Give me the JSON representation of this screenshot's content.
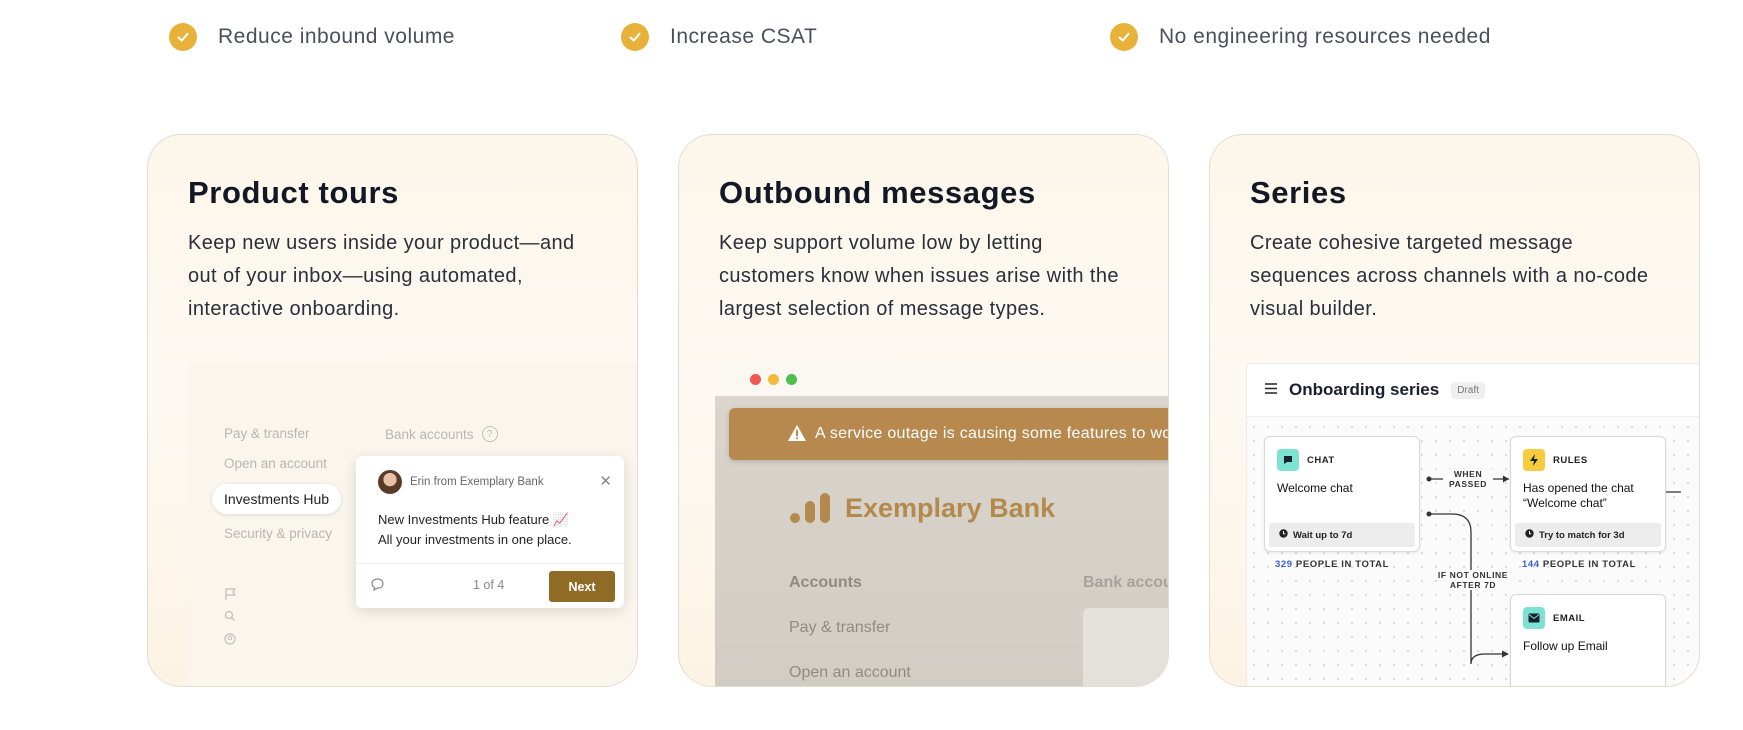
{
  "benefits": [
    {
      "label": "Reduce inbound volume"
    },
    {
      "label": "Increase CSAT"
    },
    {
      "label": "No engineering resources needed"
    }
  ],
  "colors": {
    "accent": "#e8b23a",
    "button_brown": "#8f6b26",
    "banner": "#b8894e",
    "stat_blue": "#3d5bd6"
  },
  "cards": [
    {
      "title": "Product tours",
      "description": "Keep new users inside your product—and out of your inbox—using automated, interactive onboarding.",
      "mockup": {
        "nav": [
          "Pay & transfer",
          "Open an account",
          "Investments Hub",
          "Security & privacy"
        ],
        "bank_accounts": "Bank accounts",
        "help_icon": "?",
        "tour": {
          "sender": "Erin from Exemplary Bank",
          "line1": "New Investments Hub feature 📈",
          "line2": "All your investments in one place.",
          "counter": "1 of 4",
          "next_label": "Next"
        }
      }
    },
    {
      "title": "Outbound messages",
      "description": "Keep support volume low by letting customers know when issues arise with the largest selection of message types.",
      "mockup": {
        "banner": "A service outage is causing some features to wor",
        "brand": "Exemplary Bank",
        "accounts": "Accounts",
        "bank_accounts": "Bank accou",
        "links": [
          "Pay & transfer",
          "Open an account"
        ]
      }
    },
    {
      "title": "Series",
      "description": "Create cohesive targeted message sequences across channels with a no-code visual builder.",
      "mockup": {
        "title": "Onboarding series",
        "status": "Draft",
        "nodes": {
          "chat": {
            "type": "CHAT",
            "name": "Welcome chat",
            "wait": "Wait up to 7d",
            "count": "329",
            "count_label": "PEOPLE IN TOTAL"
          },
          "rules": {
            "type": "RULES",
            "name": "Has opened the chat “Welcome chat”",
            "wait": "Try to match for 3d",
            "count": "144",
            "count_label": "PEOPLE IN TOTAL"
          },
          "email": {
            "type": "EMAIL",
            "name": "Follow up Email"
          }
        },
        "edges": {
          "when_passed": "WHEN PASSED",
          "not_online": "IF NOT ONLINE AFTER 7D"
        }
      }
    }
  ]
}
